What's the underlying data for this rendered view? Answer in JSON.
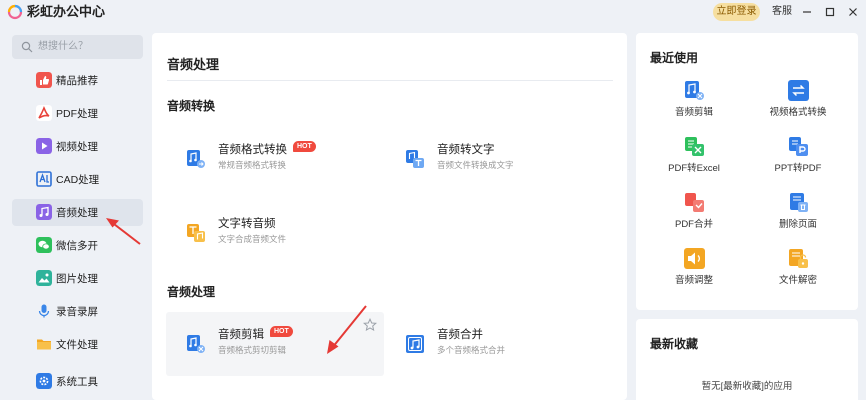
{
  "app": {
    "title": "彩虹办公中心",
    "login_label": "立即登录",
    "service_label": "客服"
  },
  "sidebar": {
    "search_placeholder": "想搜什么？",
    "items": [
      {
        "label": "精品推荐",
        "icon": "thumbs-up-icon",
        "color": "#f0554d"
      },
      {
        "label": "PDF处理",
        "icon": "pdf-icon",
        "color": "#e8423a"
      },
      {
        "label": "视频处理",
        "icon": "video-icon",
        "color": "#8a63e6"
      },
      {
        "label": "CAD处理",
        "icon": "cad-icon",
        "color": "#2b6fd6"
      },
      {
        "label": "音频处理",
        "icon": "music-note-icon",
        "color": "#8a63e6",
        "active": true
      },
      {
        "label": "微信多开",
        "icon": "wechat-icon",
        "color": "#2ec05c"
      },
      {
        "label": "图片处理",
        "icon": "image-icon",
        "color": "#2fb39b"
      },
      {
        "label": "录音录屏",
        "icon": "microphone-icon",
        "color": "#3a86e8"
      },
      {
        "label": "文件处理",
        "icon": "folder-icon",
        "color": "#f3a623"
      },
      {
        "label": "系统工具",
        "icon": "gear-icon",
        "color": "#2f7be5"
      }
    ]
  },
  "main": {
    "title": "音频处理",
    "sections": [
      {
        "title": "音频转换",
        "tools": [
          {
            "name": "音频格式转换",
            "desc": "常规音频格式转换",
            "hot": "HOT",
            "icon": "audio-convert-icon"
          },
          {
            "name": "音频转文字",
            "desc": "音频文件转换成文字",
            "icon": "audio-to-text-icon"
          },
          {
            "name": "文字转音频",
            "desc": "文字合成音频文件",
            "icon": "text-to-audio-icon"
          }
        ]
      },
      {
        "title": "音频处理",
        "tools": [
          {
            "name": "音频剪辑",
            "desc": "音频格式剪切剪辑",
            "hot": "HOT",
            "icon": "audio-cut-icon"
          },
          {
            "name": "音频合并",
            "desc": "多个音频格式合并",
            "icon": "audio-merge-icon"
          }
        ]
      }
    ]
  },
  "recent": {
    "title": "最近使用",
    "items": [
      {
        "label": "音频剪辑",
        "icon": "audio-cut-icon"
      },
      {
        "label": "视频格式转换",
        "icon": "video-convert-icon"
      },
      {
        "label": "PDF转Excel",
        "icon": "pdf-to-excel-icon"
      },
      {
        "label": "PPT转PDF",
        "icon": "ppt-to-pdf-icon"
      },
      {
        "label": "PDF合并",
        "icon": "pdf-merge-icon"
      },
      {
        "label": "删除页面",
        "icon": "delete-page-icon"
      },
      {
        "label": "音频调整",
        "icon": "audio-adjust-icon"
      },
      {
        "label": "文件解密",
        "icon": "file-decrypt-icon"
      }
    ]
  },
  "favorites": {
    "title": "最新收藏",
    "empty_text": "暂无[最新收藏]的应用"
  },
  "colors": {
    "accent_blue": "#2f7be5",
    "hot_red": "#f04a3e",
    "login_bg": "#f6dfa0",
    "annotation_red": "#e53935"
  }
}
